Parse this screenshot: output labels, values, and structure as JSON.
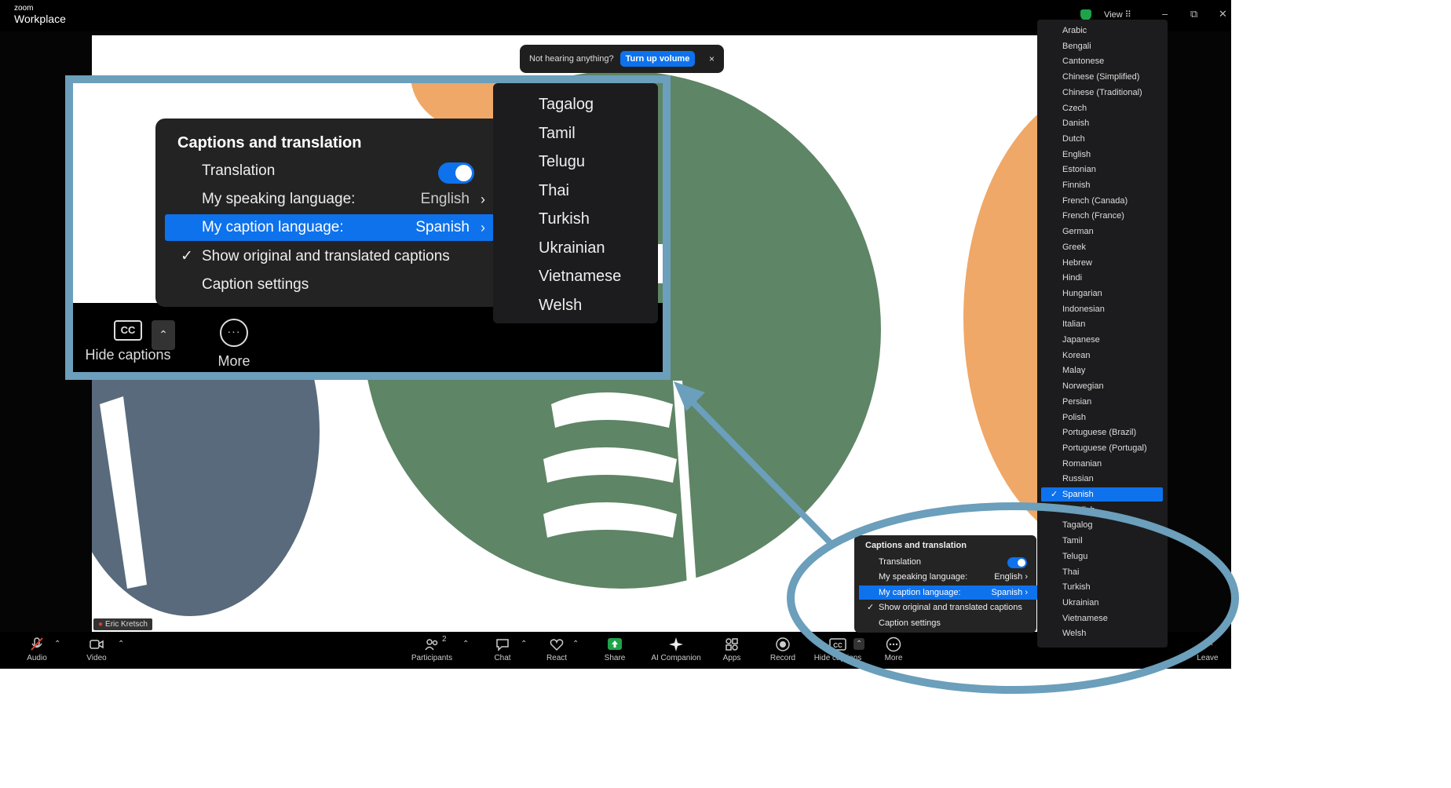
{
  "window": {
    "brand_small": "zoom",
    "brand_big": "Workplace",
    "view_label": "View",
    "minimize": "–",
    "restore": "⧉",
    "close": "✕"
  },
  "notice": {
    "text": "Not hearing anything?",
    "button": "Turn up volume",
    "close": "×"
  },
  "participant": {
    "name": "Eric Kretsch"
  },
  "toolbar": {
    "items": [
      {
        "label": "Audio"
      },
      {
        "label": "Video"
      },
      {
        "label": "Participants",
        "count": "2"
      },
      {
        "label": "Chat"
      },
      {
        "label": "React"
      },
      {
        "label": "Share"
      },
      {
        "label": "AI Companion"
      },
      {
        "label": "Apps"
      },
      {
        "label": "Record"
      },
      {
        "label": "Hide captions"
      },
      {
        "label": "More"
      },
      {
        "label": "Leave"
      }
    ]
  },
  "captions_menu": {
    "title": "Captions and translation",
    "translation_label": "Translation",
    "translation_on": true,
    "speaking_label": "My speaking language:",
    "speaking_value": "English",
    "caption_label": "My caption language:",
    "caption_value": "Spanish",
    "show_original_label": "Show original and translated captions",
    "show_original_checked": true,
    "settings_label": "Caption settings",
    "check_glyph": "✓",
    "chevron_glyph": "›"
  },
  "languages": {
    "selected": "Spanish",
    "items": [
      "Arabic",
      "Bengali",
      "Cantonese",
      "Chinese (Simplified)",
      "Chinese (Traditional)",
      "Czech",
      "Danish",
      "Dutch",
      "English",
      "Estonian",
      "Finnish",
      "French (Canada)",
      "French (France)",
      "German",
      "Greek",
      "Hebrew",
      "Hindi",
      "Hungarian",
      "Indonesian",
      "Italian",
      "Japanese",
      "Korean",
      "Malay",
      "Norwegian",
      "Persian",
      "Polish",
      "Portuguese (Brazil)",
      "Portuguese (Portugal)",
      "Romanian",
      "Russian",
      "Spanish",
      "Swedish",
      "Tagalog",
      "Tamil",
      "Telugu",
      "Thai",
      "Turkish",
      "Ukrainian",
      "Vietnamese",
      "Welsh"
    ]
  },
  "inset": {
    "languages": [
      "Tagalog",
      "Tamil",
      "Telugu",
      "Thai",
      "Turkish",
      "Ukrainian",
      "Vietnamese",
      "Welsh"
    ],
    "hide_captions_label": "Hide captions",
    "more_label": "More",
    "cc_text": "CC",
    "caret": "⌃"
  },
  "colors": {
    "accent_blue": "#0e72ed",
    "annotation_blue": "#6b9fbb",
    "shape_green": "#5e8565",
    "shape_orange": "#efa867",
    "shape_slate": "#586a7c"
  }
}
